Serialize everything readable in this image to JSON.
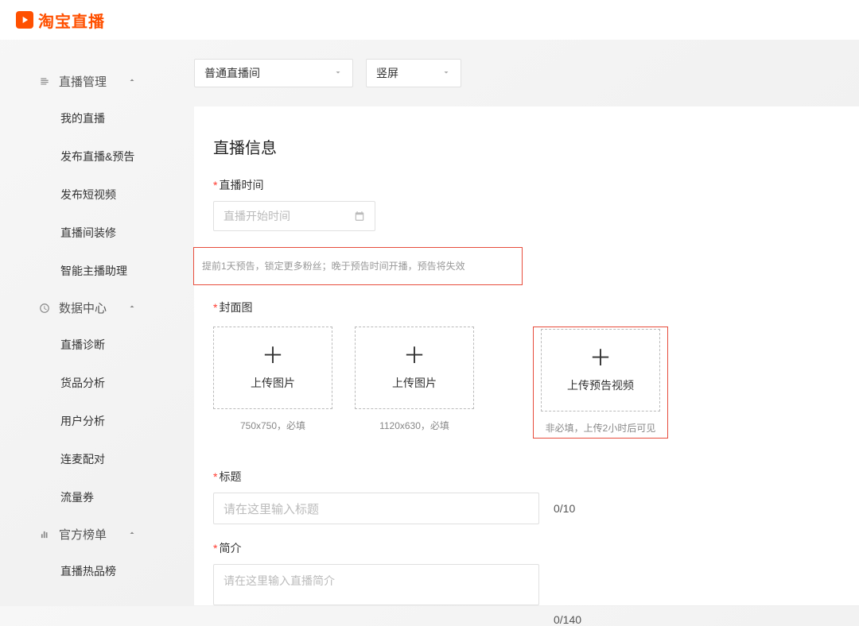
{
  "header": {
    "logo_text": "淘宝直播"
  },
  "sidebar": {
    "groups": [
      {
        "label": "直播管理",
        "items": [
          "我的直播",
          "发布直播&预告",
          "发布短视频",
          "直播间装修",
          "智能主播助理"
        ]
      },
      {
        "label": "数据中心",
        "items": [
          "直播诊断",
          "货品分析",
          "用户分析",
          "连麦配对",
          "流量券"
        ]
      },
      {
        "label": "官方榜单",
        "items": [
          "直播热品榜"
        ]
      }
    ]
  },
  "selects": {
    "room_type": "普通直播间",
    "orientation": "竖屏"
  },
  "form": {
    "section_title": "直播信息",
    "time": {
      "label": "直播时间",
      "placeholder": "直播开始时间"
    },
    "hint": "提前1天预告，锁定更多粉丝；晚于预告时间开播，预告将失效",
    "cover": {
      "label": "封面图",
      "uploads": [
        {
          "label": "上传图片",
          "hint": "750x750，必填"
        },
        {
          "label": "上传图片",
          "hint": "1120x630，必填"
        },
        {
          "label": "上传预告视频",
          "hint": "非必填，上传2小时后可见"
        }
      ]
    },
    "title": {
      "label": "标题",
      "placeholder": "请在这里输入标题",
      "counter": "0/10"
    },
    "intro": {
      "label": "简介",
      "placeholder": "请在这里输入直播简介",
      "counter": "0/140"
    }
  }
}
